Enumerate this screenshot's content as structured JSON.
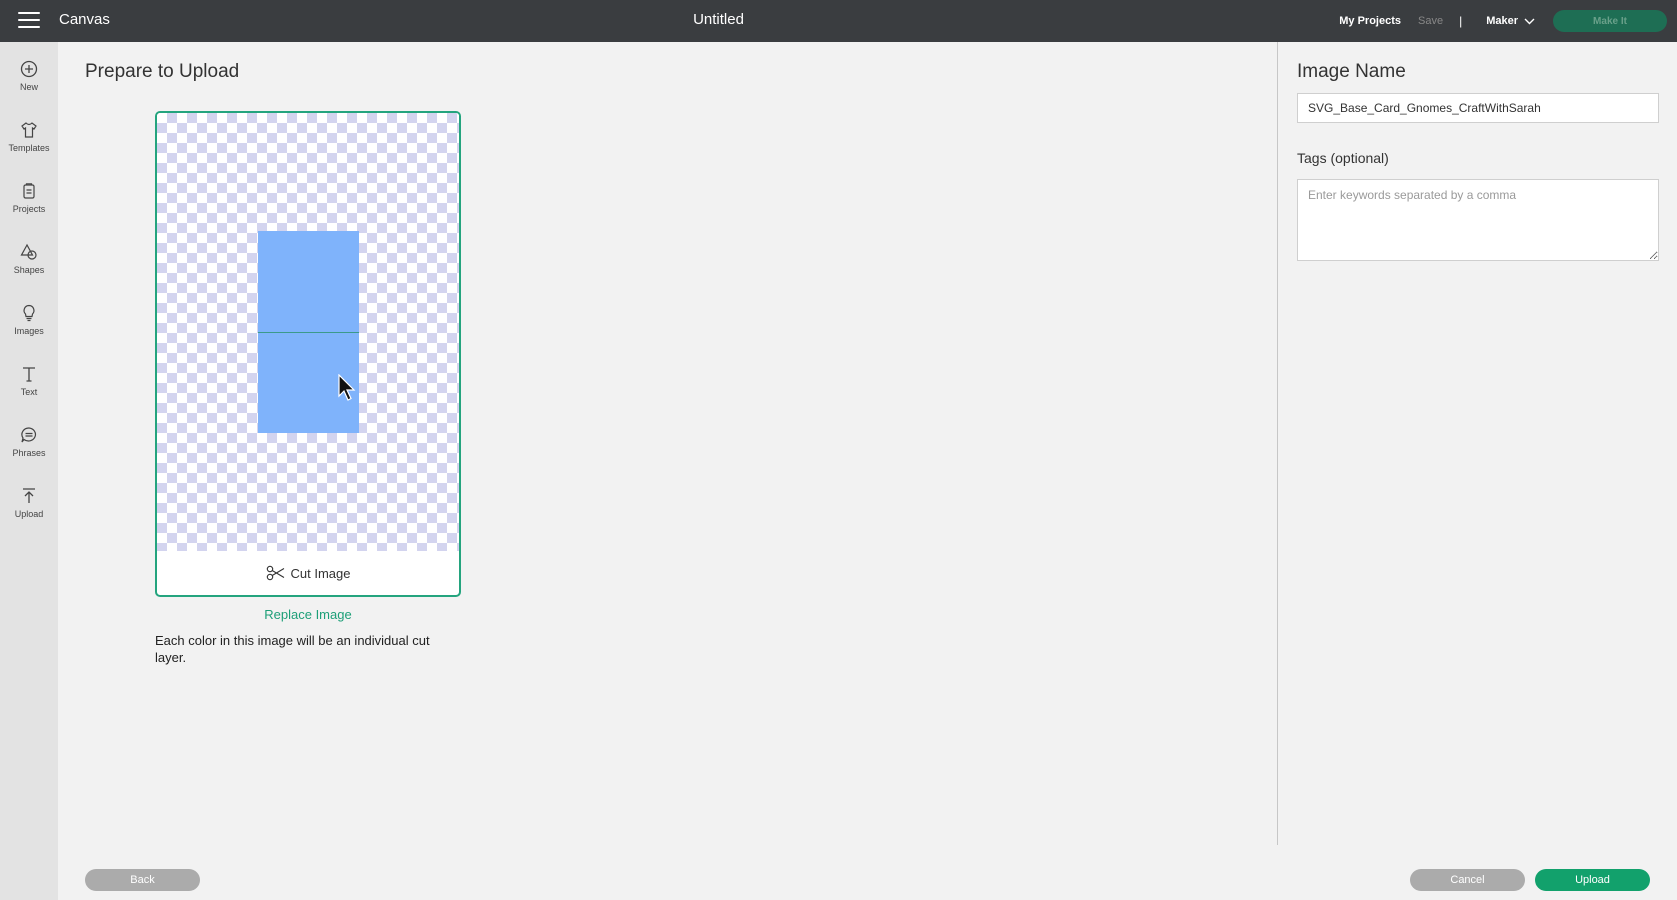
{
  "topbar": {
    "app_name": "Canvas",
    "document_title": "Untitled",
    "my_projects": "My Projects",
    "save": "Save",
    "separator": "|",
    "machine": "Maker",
    "make_it": "Make It"
  },
  "sidebar": {
    "items": [
      {
        "label": "New",
        "icon": "plus-circle-icon"
      },
      {
        "label": "Templates",
        "icon": "shirt-icon"
      },
      {
        "label": "Projects",
        "icon": "projects-icon"
      },
      {
        "label": "Shapes",
        "icon": "shapes-icon"
      },
      {
        "label": "Images",
        "icon": "lightbulb-icon"
      },
      {
        "label": "Text",
        "icon": "text-icon"
      },
      {
        "label": "Phrases",
        "icon": "speech-bubble-icon"
      },
      {
        "label": "Upload",
        "icon": "upload-arrow-icon"
      }
    ]
  },
  "main": {
    "title": "Prepare to Upload",
    "cut_option": "Cut Image",
    "replace_link": "Replace Image",
    "help_text": "Each color in this image will be an individual cut layer."
  },
  "right_panel": {
    "image_name_label": "Image Name",
    "image_name_value": "SVG_Base_Card_Gnomes_CraftWithSarah",
    "tags_label": "Tags (optional)",
    "tags_placeholder": "Enter keywords separated by a comma"
  },
  "footer": {
    "back": "Back",
    "cancel": "Cancel",
    "upload": "Upload"
  },
  "colors": {
    "topbar": "#3a3d40",
    "accent_green": "#12a16c",
    "image_blue": "#7fb3fb",
    "checker": "#d3d4ef"
  }
}
